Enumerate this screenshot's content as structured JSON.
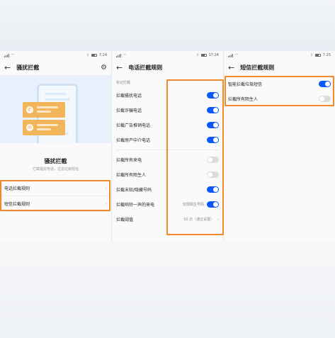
{
  "status": {
    "time_p1": "7:24",
    "time_p2": "17:24",
    "time_p3": "7:25"
  },
  "p1": {
    "title": "骚扰拦截",
    "hero_title": "骚扰拦截",
    "hero_sub": "拦截骚扰电话，过滤垃圾短信",
    "items": [
      {
        "label": "电话拦截规则"
      },
      {
        "label": "短信拦截规则"
      }
    ]
  },
  "p2": {
    "title": "电话拦截规则",
    "section": "标记拦截",
    "rows_a": [
      {
        "label": "拦截骚扰电话",
        "on": true
      },
      {
        "label": "拦截诈骗电话",
        "on": true
      },
      {
        "label": "拦截广告推销电话",
        "on": true
      },
      {
        "label": "拦截房产中介电话",
        "on": true
      }
    ],
    "rows_b": [
      {
        "label": "拦截所有来电",
        "on": false
      },
      {
        "label": "拦截所有陌生人",
        "on": false
      },
      {
        "label": "拦截未知/隐藏号码",
        "on": true
      }
    ],
    "ring_row": {
      "label": "拦截响铃一声的来电",
      "value": "仅限陌生号码",
      "on": true
    },
    "threshold_row": {
      "label": "拦截阈值",
      "value": "50 次（通过设置）"
    }
  },
  "p3": {
    "title": "短信拦截规则",
    "rows": [
      {
        "label": "智能拦截垃圾短信",
        "on": true
      },
      {
        "label": "拦截所有陌生人",
        "on": false
      }
    ]
  },
  "colors": {
    "accent": "#0a59f7",
    "highlight": "#ee8a2c",
    "bubble": "#f3b55a"
  }
}
